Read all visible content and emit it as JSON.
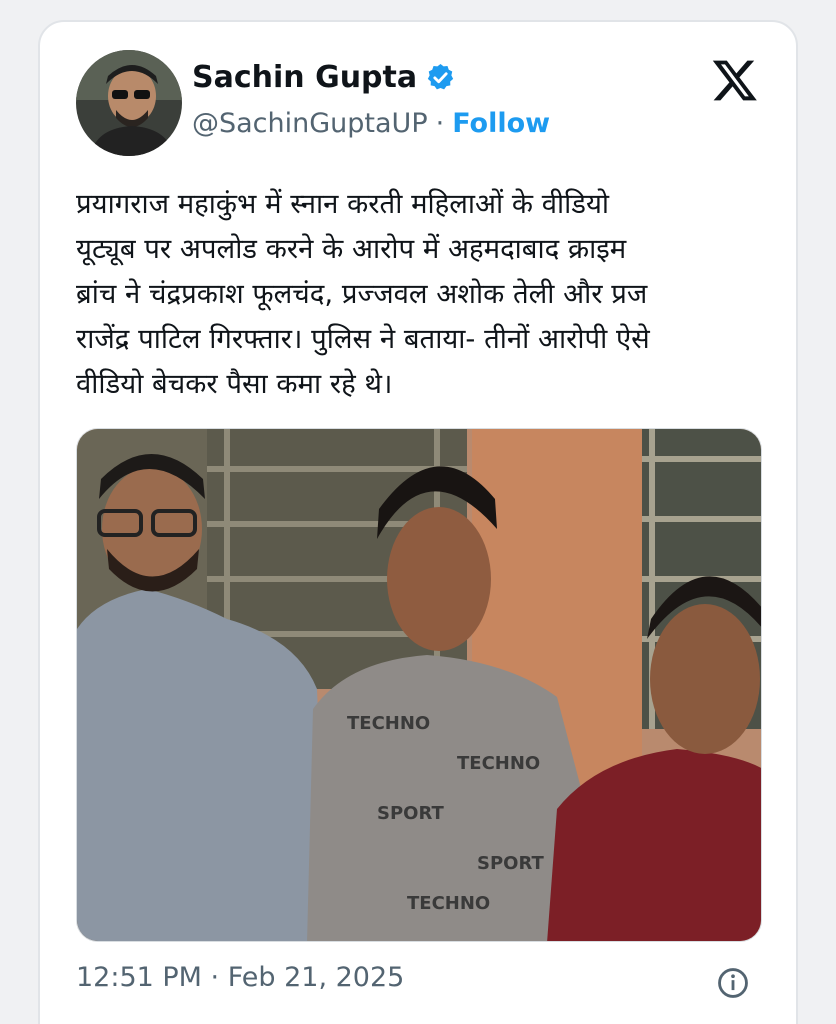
{
  "author": {
    "display_name": "Sachin Gupta",
    "handle": "@SachinGuptaUP",
    "separator": "·",
    "follow_label": "Follow",
    "verified": true
  },
  "tweet": {
    "text": "प्रयागराज महाकुंभ में स्नान करती महिलाओं के वीडियो\nयूट्यूब पर अपलोड करने के आरोप में अहमदाबाद क्राइम\nब्रांच ने चंद्रप्रकाश फूलचंद, प्रज्जवल अशोक तेली और प्रज\nराजेंद्र पाटिल गिरफ्तार। पुलिस ने बताया- तीनों आरोपी ऐसे\nवीडियो बेचकर पैसा कमा रहे थे।",
    "timestamp": "12:51 PM · Feb 21, 2025"
  },
  "colors": {
    "accent": "#1d9bf0",
    "secondary_text": "#536471",
    "primary_text": "#0f1419"
  },
  "icons": {
    "verified": "verified-badge-icon",
    "x_logo": "x-logo-icon",
    "info": "info-icon"
  }
}
